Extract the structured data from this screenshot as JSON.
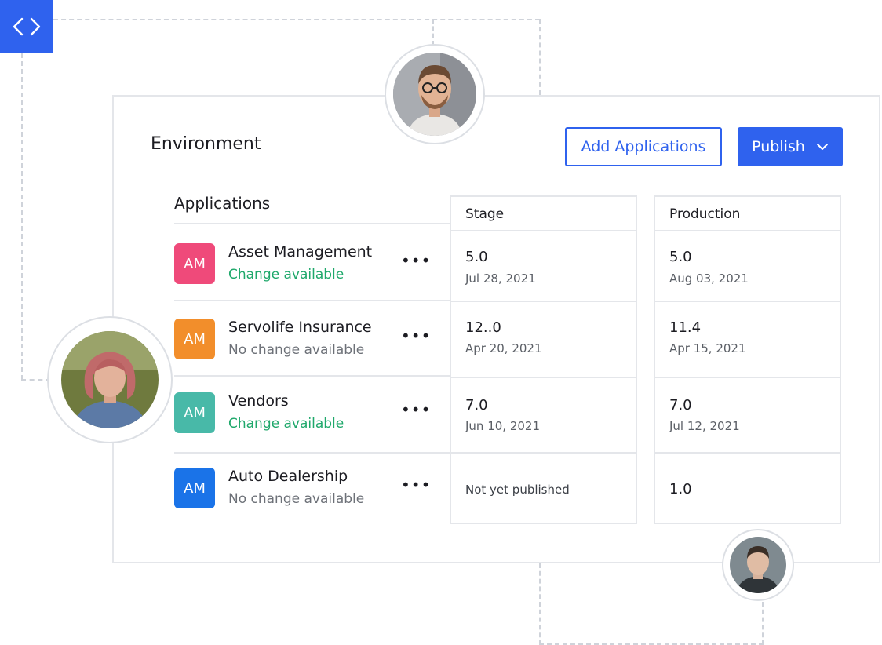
{
  "header": {
    "title": "Environment",
    "add_button": "Add Applications",
    "publish_button": "Publish"
  },
  "applications": {
    "header": "Applications",
    "items": [
      {
        "initials": "AM",
        "name": "Asset Management",
        "status": "Change available",
        "color": "#ef4a7a",
        "status_color": "#1fa86b"
      },
      {
        "initials": "AM",
        "name": "Servolife Insurance",
        "status": "No change available",
        "color": "#f28e2b",
        "status_color": "#6d7178"
      },
      {
        "initials": "AM",
        "name": "Vendors",
        "status": "Change available",
        "color": "#48b9a8",
        "status_color": "#1fa86b"
      },
      {
        "initials": "AM",
        "name": "Auto Dealership",
        "status": "No change available",
        "color": "#1a73e8",
        "status_color": "#6d7178"
      }
    ]
  },
  "stage": {
    "header": "Stage",
    "rows": [
      {
        "version": "5.0",
        "date": "Jul 28, 2021"
      },
      {
        "version": "12..0",
        "date": "Apr 20, 2021"
      },
      {
        "version": "7.0",
        "date": "Jun 10, 2021"
      },
      {
        "status": "Not yet published"
      }
    ]
  },
  "production": {
    "header": "Production",
    "rows": [
      {
        "version": "5.0",
        "date": "Aug 03, 2021"
      },
      {
        "version": "11.4",
        "date": "Apr 15, 2021"
      },
      {
        "version": "7.0",
        "date": "Jul 12, 2021"
      },
      {
        "version": "1.0"
      }
    ]
  },
  "colors": {
    "accent": "#2f62ee",
    "border": "#e4e6ea",
    "dashed": "#cfd3da"
  }
}
